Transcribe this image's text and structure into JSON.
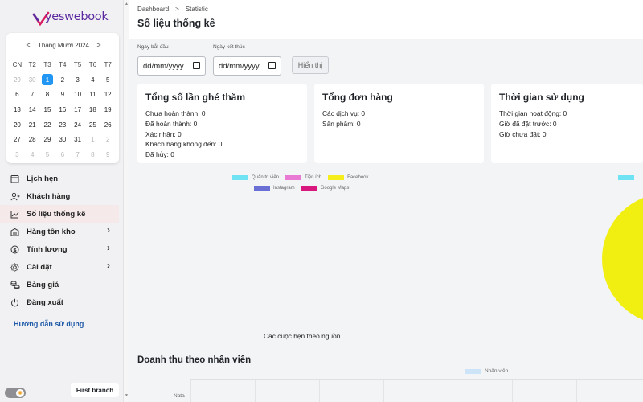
{
  "brand": {
    "name": "yeswebook"
  },
  "calendar": {
    "month_label": "Tháng Mười 2024",
    "prev": "<",
    "next": ">",
    "weekdays": [
      "CN",
      "T2",
      "T3",
      "T4",
      "T5",
      "T6",
      "T7"
    ],
    "days": [
      {
        "d": "29",
        "m": true
      },
      {
        "d": "30",
        "m": true
      },
      {
        "d": "1",
        "t": true
      },
      {
        "d": "2"
      },
      {
        "d": "3"
      },
      {
        "d": "4"
      },
      {
        "d": "5"
      },
      {
        "d": "6"
      },
      {
        "d": "7"
      },
      {
        "d": "8"
      },
      {
        "d": "9"
      },
      {
        "d": "10"
      },
      {
        "d": "11"
      },
      {
        "d": "12"
      },
      {
        "d": "13"
      },
      {
        "d": "14"
      },
      {
        "d": "15"
      },
      {
        "d": "16"
      },
      {
        "d": "17"
      },
      {
        "d": "18"
      },
      {
        "d": "19"
      },
      {
        "d": "20"
      },
      {
        "d": "21"
      },
      {
        "d": "22"
      },
      {
        "d": "23"
      },
      {
        "d": "24"
      },
      {
        "d": "25"
      },
      {
        "d": "26"
      },
      {
        "d": "27"
      },
      {
        "d": "28"
      },
      {
        "d": "29"
      },
      {
        "d": "30"
      },
      {
        "d": "31"
      },
      {
        "d": "1",
        "m": true
      },
      {
        "d": "2",
        "m": true
      },
      {
        "d": "3",
        "m": true
      },
      {
        "d": "4",
        "m": true
      },
      {
        "d": "5",
        "m": true
      },
      {
        "d": "6",
        "m": true
      },
      {
        "d": "7",
        "m": true
      },
      {
        "d": "8",
        "m": true
      },
      {
        "d": "9",
        "m": true
      }
    ]
  },
  "sidebar": {
    "items": [
      {
        "label": "Lịch hẹn",
        "icon": "calendar-icon"
      },
      {
        "label": "Khách hàng",
        "icon": "user-add-icon"
      },
      {
        "label": "Số liệu thống kê",
        "icon": "chart-line-icon"
      },
      {
        "label": "Hàng tồn kho",
        "icon": "warehouse-icon"
      },
      {
        "label": "Tính lương",
        "icon": "dollar-icon"
      },
      {
        "label": "Cài đặt",
        "icon": "gear-icon"
      },
      {
        "label": "Bảng giá",
        "icon": "coins-icon"
      },
      {
        "label": "Đăng xuất",
        "icon": "power-icon"
      }
    ],
    "guide_link": "Hướng dẫn sử dụng",
    "branch_button": "First branch"
  },
  "header": {
    "breadcrumb": [
      "Dashboard",
      "Statistic"
    ],
    "breadcrumb_sep": ">",
    "title": "Số liệu thống kê"
  },
  "filters": {
    "start_label": "Ngày bắt đầu",
    "end_label": "Ngày kết thúc",
    "start_value": "dd/mm/yyyy",
    "end_value": "dd/mm/yyyy",
    "show_button": "Hiển thị"
  },
  "cards": {
    "visits": {
      "title": "Tổng số lần ghé thăm",
      "lines": [
        "Chưa hoàn thành: 0",
        "Đã hoàn thành: 0",
        "Xác nhận: 0",
        "Khách hàng không đến: 0",
        "Đã hủy: 0"
      ]
    },
    "orders": {
      "title": "Tổng đơn hàng",
      "lines": [
        "Các dịch vụ: 0",
        "Sản phẩm: 0"
      ]
    },
    "time": {
      "title": "Thời gian sử dụng",
      "lines": [
        "Thời gian hoạt động: 0",
        "Giờ đã đặt trước: 0",
        "Giờ chưa đặt: 0"
      ]
    }
  },
  "chart_data": {
    "type": "pie",
    "caption": "Các cuộc hẹn theo nguồn",
    "legend": [
      {
        "name": "Quản trị viên",
        "color": "#6fe3f3"
      },
      {
        "name": "Tiện ích",
        "color": "#e87ad3"
      },
      {
        "name": "Facebook",
        "color": "#f5ee1a"
      },
      {
        "name": "Instagram",
        "color": "#6a6fd6"
      },
      {
        "name": "Google Maps",
        "color": "#d8187c"
      }
    ],
    "partial_legend_color": "#6fe3f3",
    "pie_color": "#f1ee12"
  },
  "revenue": {
    "title": "Doanh thu theo nhân viên",
    "legend": "Nhân viên",
    "legend_color": "#cde3f7",
    "row_label": "Nata"
  },
  "colors": {
    "accent": "#2196f3",
    "active_bg": "#f5e9ea",
    "link": "#1e5aa8"
  }
}
